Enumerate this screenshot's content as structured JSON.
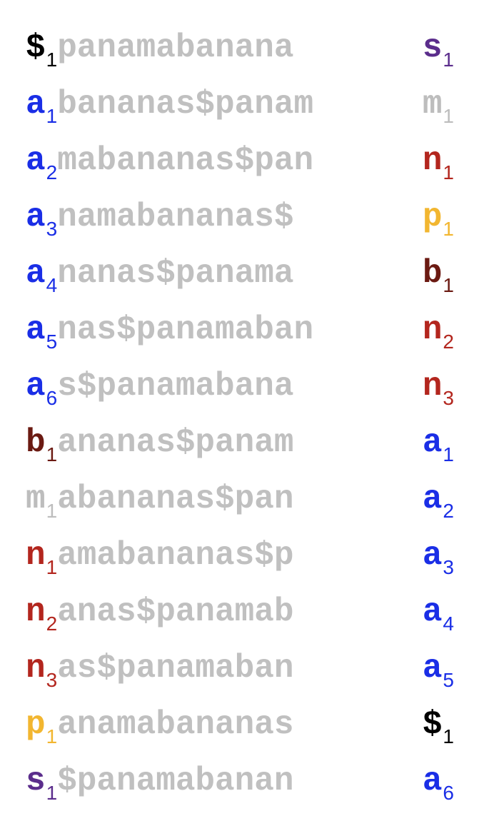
{
  "colors": {
    "$": "#000000",
    "a": "#1a2ee6",
    "b": "#6b1a12",
    "m": "#bdbdbd",
    "n": "#b3261e",
    "p": "#f2b630",
    "s": "#5b2d8c",
    "middle": "#c0c0c0"
  },
  "rows": [
    {
      "first": "$",
      "first_sub": "1",
      "middle": "panamabanana",
      "last": "s",
      "last_sub": "1"
    },
    {
      "first": "a",
      "first_sub": "1",
      "middle": "bananas$panam",
      "last": "m",
      "last_sub": "1"
    },
    {
      "first": "a",
      "first_sub": "2",
      "middle": "mabananas$pan",
      "last": "n",
      "last_sub": "1"
    },
    {
      "first": "a",
      "first_sub": "3",
      "middle": "namabananas$",
      "last": "p",
      "last_sub": "1"
    },
    {
      "first": "a",
      "first_sub": "4",
      "middle": "nanas$panama",
      "last": "b",
      "last_sub": "1"
    },
    {
      "first": "a",
      "first_sub": "5",
      "middle": "nas$panamaban",
      "last": "n",
      "last_sub": "2"
    },
    {
      "first": "a",
      "first_sub": "6",
      "middle": "s$panamabana",
      "last": "n",
      "last_sub": "3"
    },
    {
      "first": "b",
      "first_sub": "1",
      "middle": "ananas$panam",
      "last": "a",
      "last_sub": "1"
    },
    {
      "first": "m",
      "first_sub": "1",
      "middle": "abananas$pan",
      "last": "a",
      "last_sub": "2"
    },
    {
      "first": "n",
      "first_sub": "1",
      "middle": "amabananas$p",
      "last": "a",
      "last_sub": "3"
    },
    {
      "first": "n",
      "first_sub": "2",
      "middle": "anas$panamab",
      "last": "a",
      "last_sub": "4"
    },
    {
      "first": "n",
      "first_sub": "3",
      "middle": "as$panamaban",
      "last": "a",
      "last_sub": "5"
    },
    {
      "first": "p",
      "first_sub": "1",
      "middle": "anamabananas",
      "last": "$",
      "last_sub": "1"
    },
    {
      "first": "s",
      "first_sub": "1",
      "middle": "$panamabanan",
      "last": "a",
      "last_sub": "6"
    }
  ]
}
